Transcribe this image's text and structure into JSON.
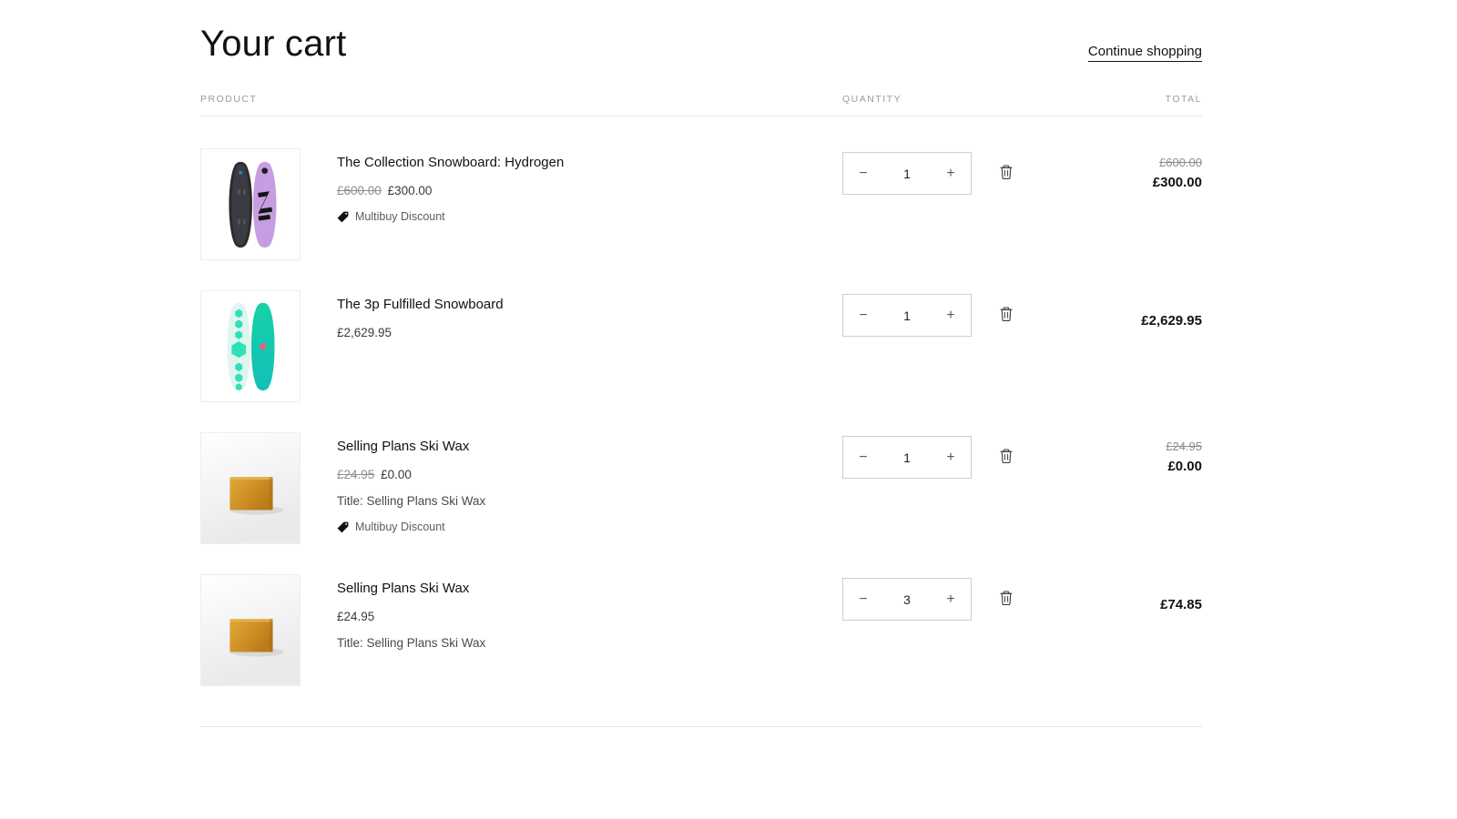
{
  "header": {
    "title": "Your cart",
    "continue_shopping": "Continue shopping"
  },
  "columns": {
    "product": "PRODUCT",
    "quantity": "QUANTITY",
    "total": "TOTAL"
  },
  "controls": {
    "decrease": "−",
    "increase": "+",
    "remove_icon": "trash-icon",
    "discount_icon": "price-tag-icon"
  },
  "colors": {
    "text": "#121212",
    "muted": "#8d8d8d",
    "rule": "#e6e6e6",
    "border": "#cfcfcf",
    "board_purple": "#c79ce0",
    "board_dark": "#2b2b2f",
    "board_teal": "#14c8a8",
    "board_mint": "#d8f4ec",
    "wax_amber": "#d39a2c",
    "dot_pink": "#ef5f7a"
  },
  "items": [
    {
      "title": "The Collection Snowboard: Hydrogen",
      "price_old": "£600.00",
      "price_new": "£300.00",
      "variant": "",
      "discount": "Multibuy Discount",
      "quantity": "1",
      "total_old": "£600.00",
      "total_new": "£300.00",
      "image": "snowboard-hydrogen"
    },
    {
      "title": "The 3p Fulfilled Snowboard",
      "price_old": "",
      "price_new": "£2,629.95",
      "variant": "",
      "discount": "",
      "quantity": "1",
      "total_old": "",
      "total_new": "£2,629.95",
      "image": "snowboard-teal"
    },
    {
      "title": "Selling Plans Ski Wax",
      "price_old": "£24.95",
      "price_new": "£0.00",
      "variant": "Title: Selling Plans Ski Wax",
      "discount": "Multibuy Discount",
      "quantity": "1",
      "total_old": "£24.95",
      "total_new": "£0.00",
      "image": "ski-wax"
    },
    {
      "title": "Selling Plans Ski Wax",
      "price_old": "",
      "price_new": "£24.95",
      "variant": "Title: Selling Plans Ski Wax",
      "discount": "",
      "quantity": "3",
      "total_old": "",
      "total_new": "£74.85",
      "image": "ski-wax"
    }
  ]
}
